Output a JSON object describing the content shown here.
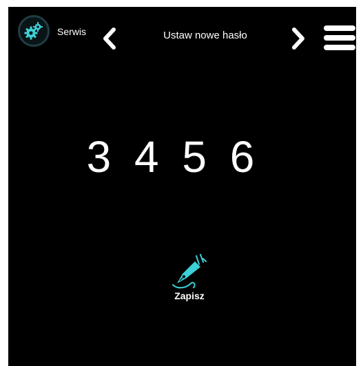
{
  "header": {
    "service_label": "Serwis",
    "title": "Ustaw nowe hasło"
  },
  "pin": {
    "value": "3 4 5 6"
  },
  "save": {
    "label": "Zapisz"
  },
  "icons": {
    "service": "gears-icon",
    "prev": "chevron-left-icon",
    "next": "chevron-right-icon",
    "menu": "hamburger-menu-icon",
    "save": "fountain-pen-icon"
  },
  "colors": {
    "background": "#000000",
    "accent": "#3dd0d6",
    "text": "#ffffff"
  }
}
